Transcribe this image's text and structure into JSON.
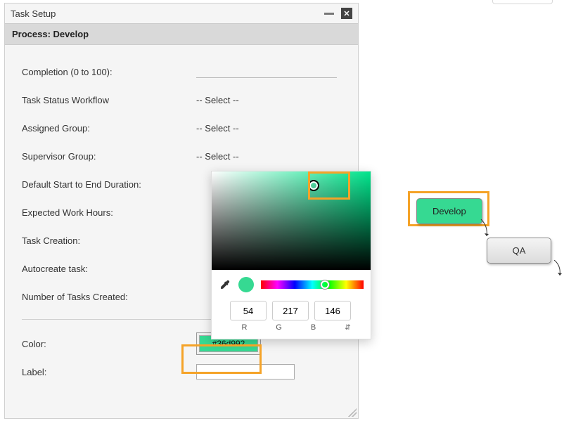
{
  "dialog": {
    "title": "Task Setup",
    "subtitle": "Process: Develop"
  },
  "form": {
    "labels": {
      "completion": "Completion (0 to 100):",
      "workflow": "Task Status Workflow",
      "assigned": "Assigned Group:",
      "supervisor": "Supervisor Group:",
      "duration": "Default Start to End Duration:",
      "expected": "Expected Work Hours:",
      "creation": "Task Creation:",
      "autocreate": "Autocreate task:",
      "numtasks": "Number of Tasks Created:",
      "color": "Color:",
      "label": "Label:"
    },
    "values": {
      "select_placeholder": "-- Select --",
      "color_hex": "#36d992",
      "label_value": ""
    }
  },
  "picker": {
    "r": "54",
    "g": "217",
    "b": "146",
    "channel_r": "R",
    "channel_g": "G",
    "channel_b": "B",
    "swatch_color": "#36d992"
  },
  "flow": {
    "develop": "Develop",
    "qa": "QA"
  }
}
